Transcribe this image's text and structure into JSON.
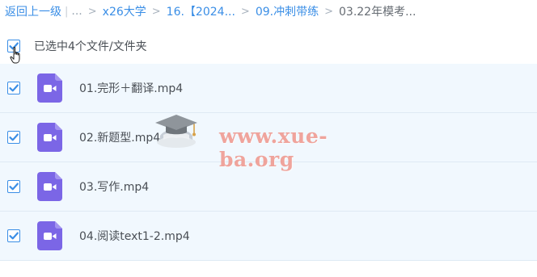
{
  "breadcrumb": {
    "back": "返回上一级",
    "ellipsis": "...",
    "items": [
      {
        "label": "x26大学"
      },
      {
        "label": "16.【2024..."
      },
      {
        "label": "09.冲刺带练"
      },
      {
        "label": "03.22年模考..."
      }
    ]
  },
  "selection": {
    "label": "已选中4个文件/文件夹"
  },
  "files": [
    {
      "name": "01.完形＋翻译.mp4"
    },
    {
      "name": "02.新题型.mp4"
    },
    {
      "name": "03.写作.mp4"
    },
    {
      "name": "04.阅读text1-2.mp4"
    }
  ],
  "watermark": {
    "text": "www.xue-ba.org"
  },
  "colors": {
    "accent": "#3a8ee6",
    "row_bg": "#f1f8fe",
    "video_icon": "#7b66e6",
    "watermark": "#ec8276"
  }
}
